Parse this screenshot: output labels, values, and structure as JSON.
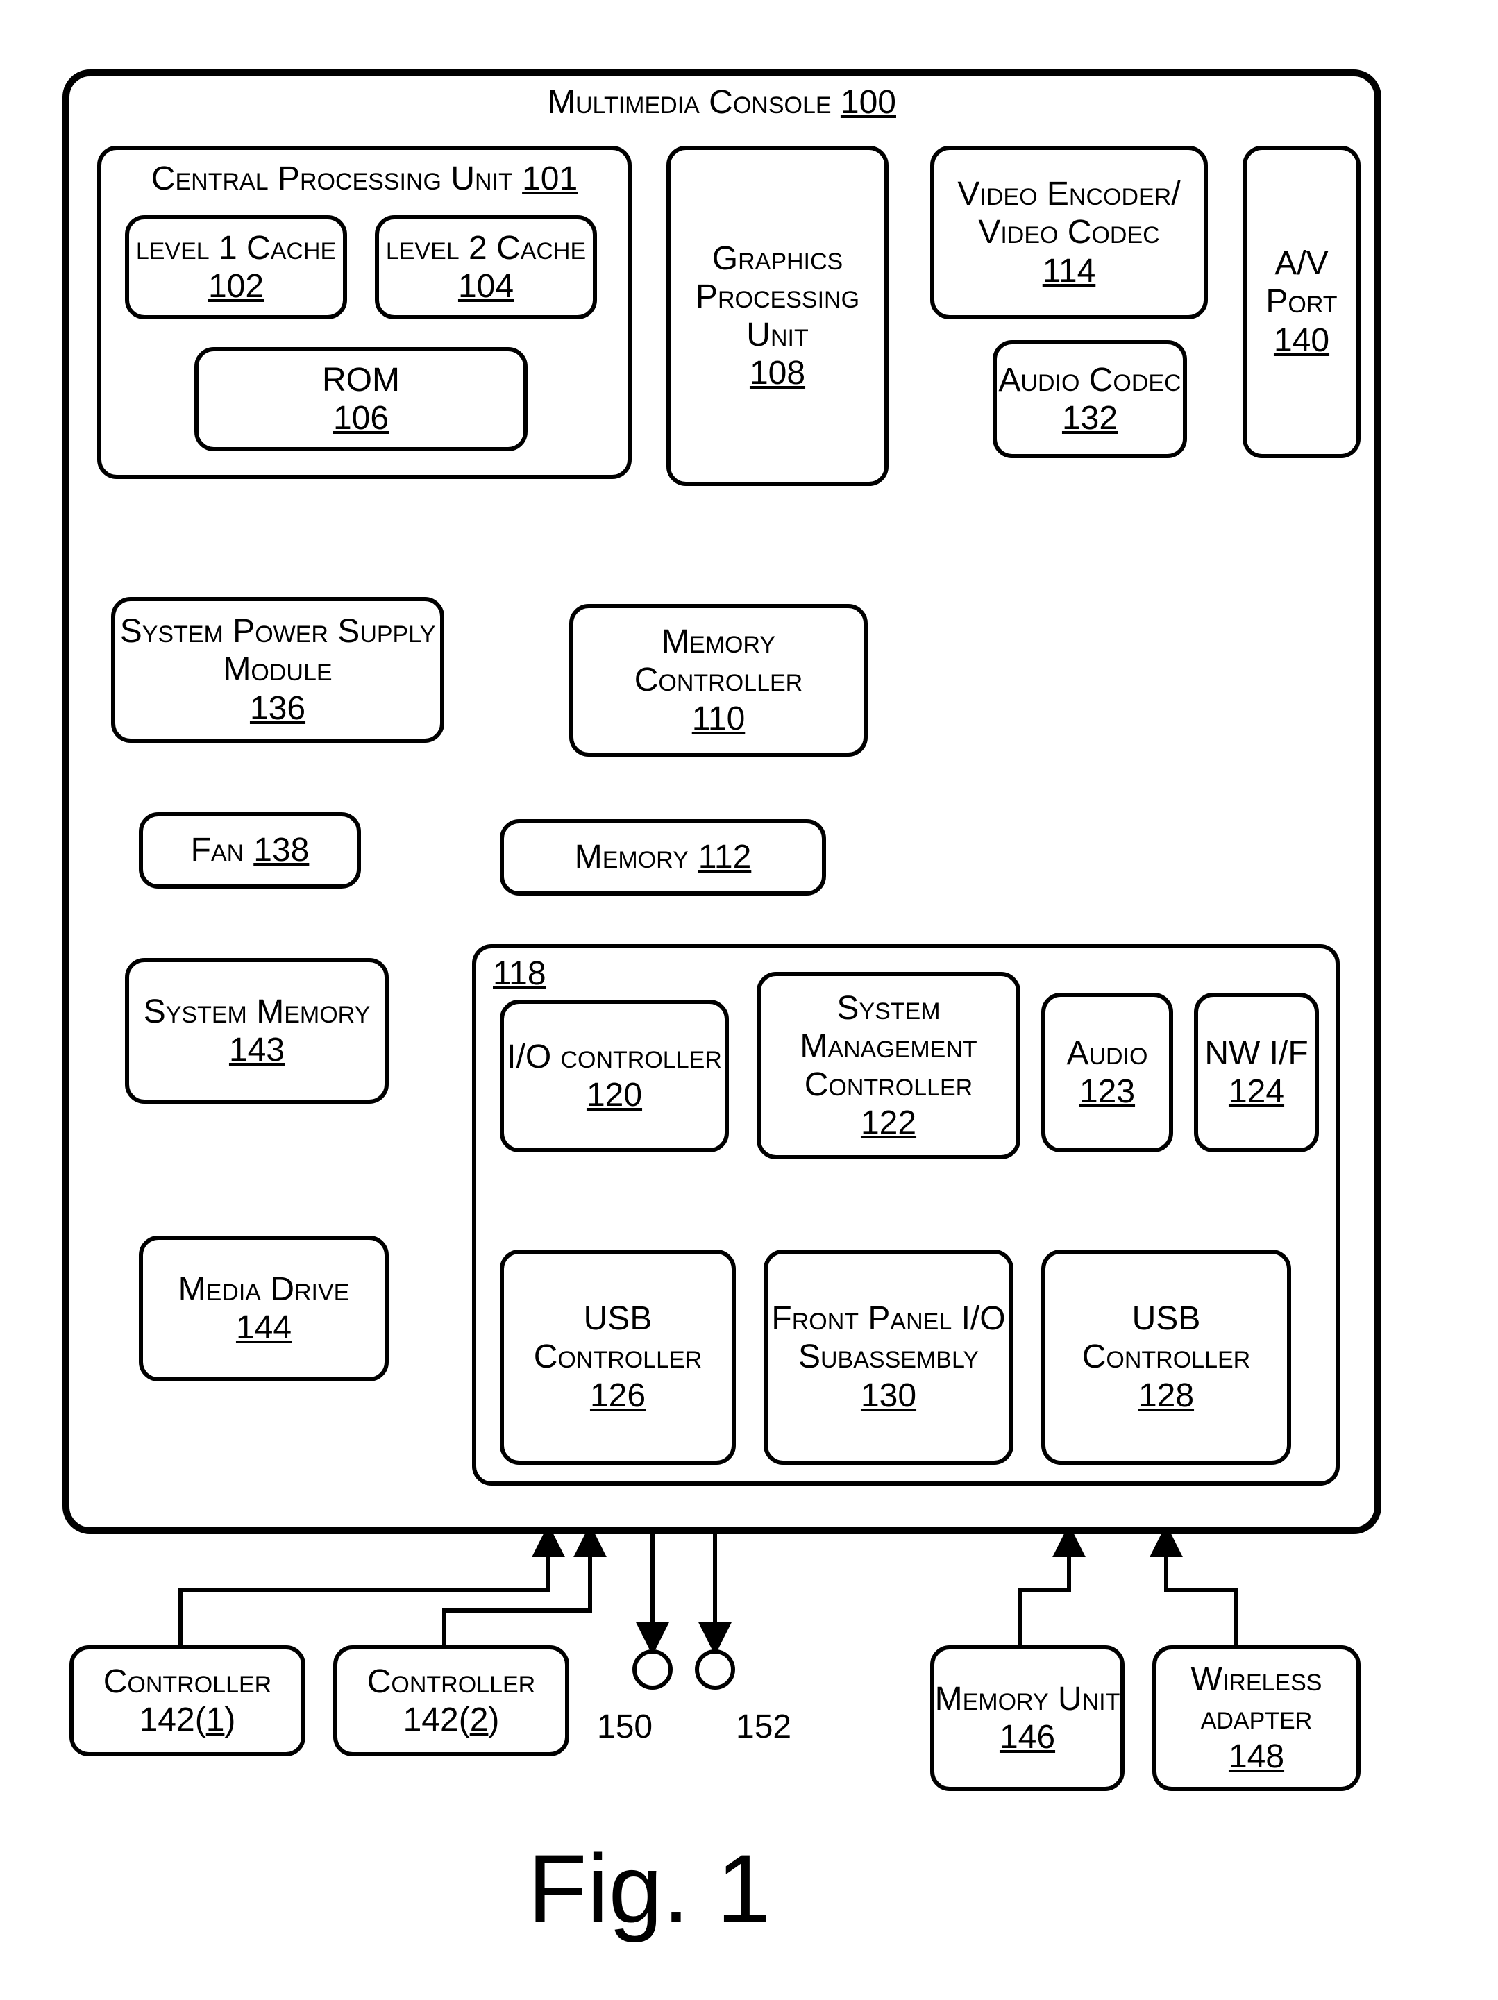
{
  "figure_label": "Fig. 1",
  "console": {
    "name": "Multimedia Console",
    "ref": "100"
  },
  "cpu": {
    "name": "Central Processing Unit",
    "ref": "101"
  },
  "l1": {
    "name": "level 1 Cache",
    "ref": "102"
  },
  "l2": {
    "name": "level 2 Cache",
    "ref": "104"
  },
  "rom": {
    "name": "ROM",
    "ref": "106"
  },
  "gpu": {
    "name": "Graphics Processing Unit",
    "ref": "108"
  },
  "memctl": {
    "name": "Memory Controller",
    "ref": "110"
  },
  "memory": {
    "name": "Memory",
    "ref": "112"
  },
  "venc": {
    "name": "Video Encoder/ Video Codec",
    "ref": "114"
  },
  "io_hub": {
    "ref": "118"
  },
  "ioctl": {
    "name": "I/O controller",
    "ref": "120"
  },
  "smc": {
    "name": "System Management Controller",
    "ref": "122"
  },
  "audio": {
    "name": "Audio",
    "ref": "123"
  },
  "nwif": {
    "name": "NW I/F",
    "ref": "124"
  },
  "usb1": {
    "name": "USB Controller",
    "ref": "126"
  },
  "usb2": {
    "name": "USB Controller",
    "ref": "128"
  },
  "frontp": {
    "name": "Front Panel I/O Subassembly",
    "ref": "130"
  },
  "acodec": {
    "name": "Audio Codec",
    "ref": "132"
  },
  "psu": {
    "name": "System Power Supply Module",
    "ref": "136"
  },
  "fan": {
    "name": "Fan",
    "ref": "138"
  },
  "avport": {
    "name": "A/V Port",
    "ref": "140"
  },
  "ctrl1": {
    "name": "Controller",
    "ref": "142(1)"
  },
  "ctrl2": {
    "name": "Controller",
    "ref": "142(2)"
  },
  "sysmem": {
    "name": "System Memory",
    "ref": "143"
  },
  "mdrive": {
    "name": "Media Drive",
    "ref": "144"
  },
  "memunit": {
    "name": "Memory Unit",
    "ref": "146"
  },
  "wadapt": {
    "name": "Wireless adapter",
    "ref": "148"
  },
  "btn150": {
    "ref": "150"
  },
  "btn152": {
    "ref": "152"
  }
}
